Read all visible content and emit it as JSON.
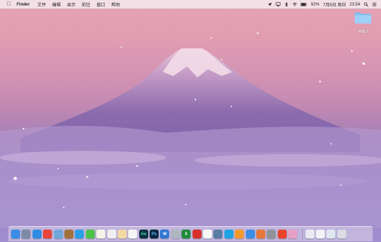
{
  "menubar": {
    "apple_icon": "apple-icon",
    "app_name": "Finder",
    "menus": [
      "文件",
      "编辑",
      "显示",
      "前往",
      "窗口",
      "帮助"
    ],
    "status": {
      "battery_percent": "92%",
      "date": "7月5日 周日",
      "time": "23:54"
    },
    "tray_icons": [
      "location-icon",
      "airplay-icon",
      "bluetooth-icon",
      "wifi-icon",
      "battery-icon",
      "search-icon",
      "list-icon"
    ]
  },
  "desktop": {
    "folder_label": "桌面 2"
  },
  "dock": {
    "apps": [
      {
        "name": "finder",
        "color": "#3b8ee8",
        "glyph": ""
      },
      {
        "name": "launchpad",
        "color": "#7c8aa6",
        "glyph": ""
      },
      {
        "name": "safari",
        "color": "#2f8de4",
        "glyph": ""
      },
      {
        "name": "chrome",
        "color": "#e8453c",
        "glyph": ""
      },
      {
        "name": "preview",
        "color": "#6fa8dc",
        "glyph": ""
      },
      {
        "name": "books",
        "color": "#a0713b",
        "glyph": ""
      },
      {
        "name": "qq",
        "color": "#2a9fe6",
        "glyph": ""
      },
      {
        "name": "messages",
        "color": "#4fc24a",
        "glyph": ""
      },
      {
        "name": "notes",
        "color": "#f5f2e8",
        "glyph": ""
      },
      {
        "name": "textedit",
        "color": "#efefef",
        "glyph": ""
      },
      {
        "name": "pages",
        "color": "#f3d9a3",
        "glyph": ""
      },
      {
        "name": "calendar",
        "color": "#f4f4f4",
        "glyph": ""
      },
      {
        "name": "audition",
        "color": "#0d2f3f",
        "glyph": "Au"
      },
      {
        "name": "photoshop",
        "color": "#0b2942",
        "glyph": "Ps"
      },
      {
        "name": "word",
        "color": "#2e76d3",
        "glyph": "W"
      },
      {
        "name": "system",
        "color": "#b0b6bf",
        "glyph": ""
      },
      {
        "name": "excel",
        "color": "#1f8a3b",
        "glyph": "X"
      },
      {
        "name": "netease-music",
        "color": "#d6302a",
        "glyph": ""
      },
      {
        "name": "photos",
        "color": "#f7f7f7",
        "glyph": ""
      },
      {
        "name": "bird",
        "color": "#5a7da3",
        "glyph": ""
      },
      {
        "name": "qq-penguin",
        "color": "#1fa3e2",
        "glyph": ""
      },
      {
        "name": "ibooks",
        "color": "#f39a2e",
        "glyph": ""
      },
      {
        "name": "appstore",
        "color": "#3a8ee6",
        "glyph": ""
      },
      {
        "name": "vpn",
        "color": "#e6763a",
        "glyph": ""
      },
      {
        "name": "system-preferences",
        "color": "#8f949b",
        "glyph": ""
      },
      {
        "name": "reeder",
        "color": "#e8452f",
        "glyph": ""
      },
      {
        "name": "petal",
        "color": "#e7a0c6",
        "glyph": ""
      }
    ],
    "trailing": [
      {
        "name": "downloads",
        "color": "#eaeaf2"
      },
      {
        "name": "documents",
        "color": "#f1f1f6"
      },
      {
        "name": "desktop-stack",
        "color": "#dfe7f1"
      },
      {
        "name": "trash",
        "color": "#d9dce3"
      }
    ]
  }
}
